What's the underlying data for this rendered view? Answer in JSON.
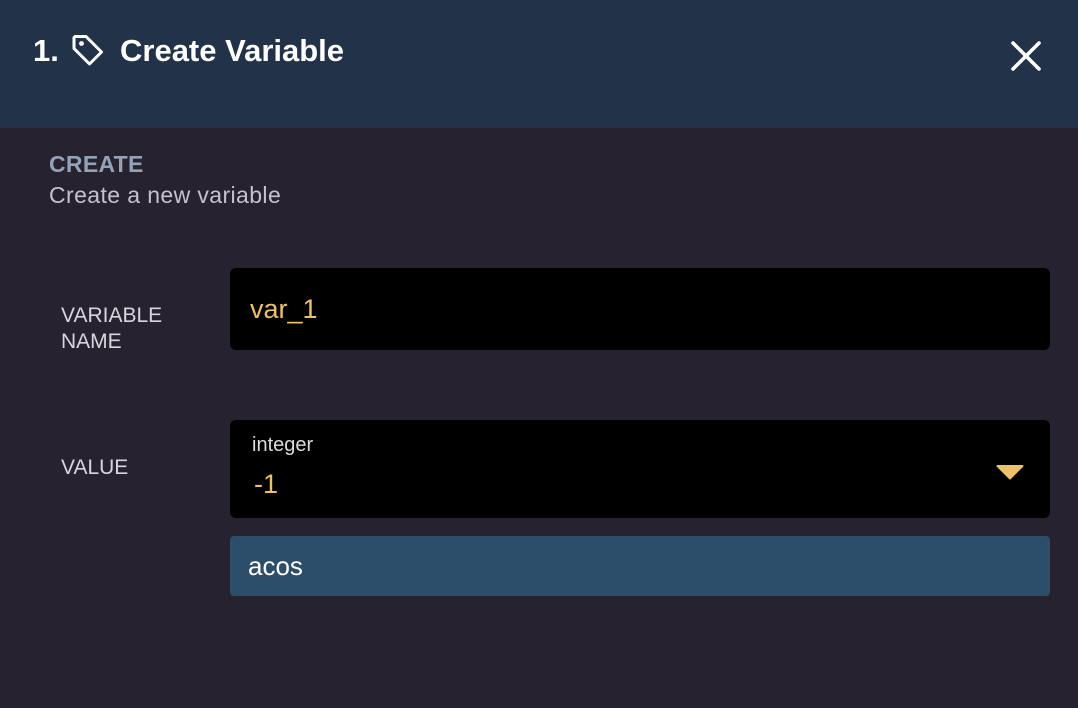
{
  "header": {
    "step": "1.",
    "icon": "tag-icon",
    "title": "Create Variable",
    "close_icon": "close-icon"
  },
  "section": {
    "title": "CREATE",
    "description": "Create a new variable"
  },
  "fields": {
    "variable_name": {
      "label": "VARIABLE NAME",
      "value": "var_1"
    },
    "value": {
      "label": "VALUE",
      "type": "integer",
      "selected": "-1",
      "dropdown_icon": "caret-down-icon",
      "option": "acos"
    }
  },
  "colors": {
    "header_bg": "#223249",
    "body_bg": "#272230",
    "accent_value": "#eec068",
    "option_bg": "#2c4e6b"
  }
}
